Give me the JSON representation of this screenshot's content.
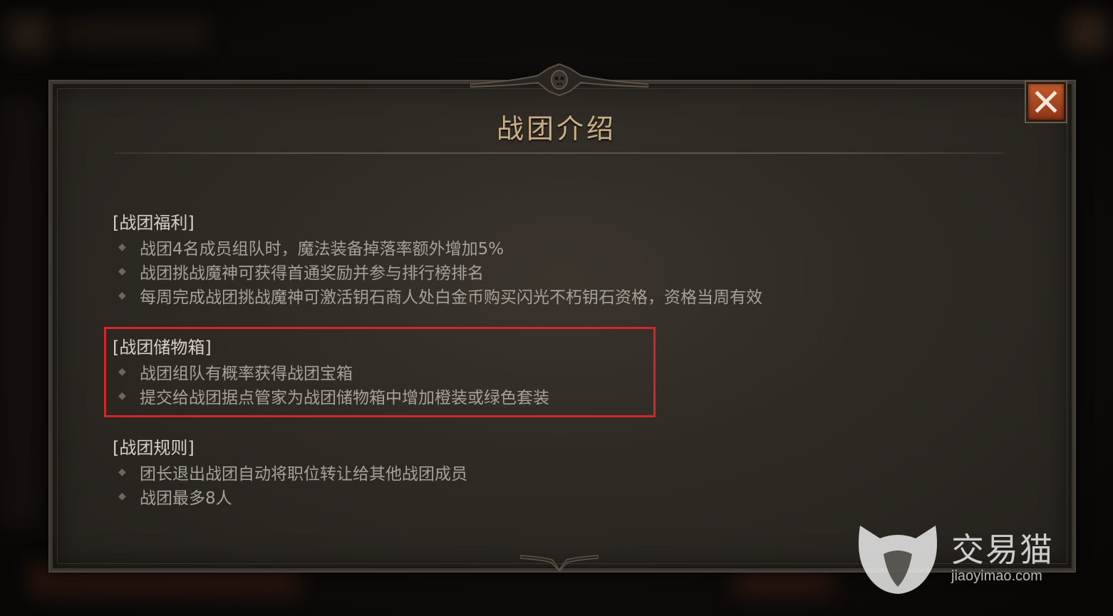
{
  "dialog": {
    "title": "战团介绍",
    "close_icon": "close-icon"
  },
  "sections": [
    {
      "heading": "[战团福利]",
      "items": [
        "战团4名成员组队时，魔法装备掉落率额外增加5%",
        "战团挑战魔神可获得首通奖励并参与排行榜排名",
        "每周完成战团挑战魔神可激活钥石商人处白金币购买闪光不朽钥石资格，资格当周有效"
      ]
    },
    {
      "heading": "[战团储物箱]",
      "items": [
        "战团组队有概率获得战团宝箱",
        "提交给战团据点管家为战团储物箱中增加橙装或绿色套装"
      ]
    },
    {
      "heading": "[战团规则]",
      "items": [
        "团长退出战团自动将职位转让给其他战团成员",
        "战团最多8人"
      ]
    }
  ],
  "bullet_glyph": "◆",
  "watermark": {
    "brand": "交易猫",
    "url": "jiaoyimao.com",
    "icon": "cat-logo-icon"
  },
  "colors": {
    "highlight_border": "#d4242c",
    "title": "#c9ae86",
    "close_button": "#b04a22"
  }
}
